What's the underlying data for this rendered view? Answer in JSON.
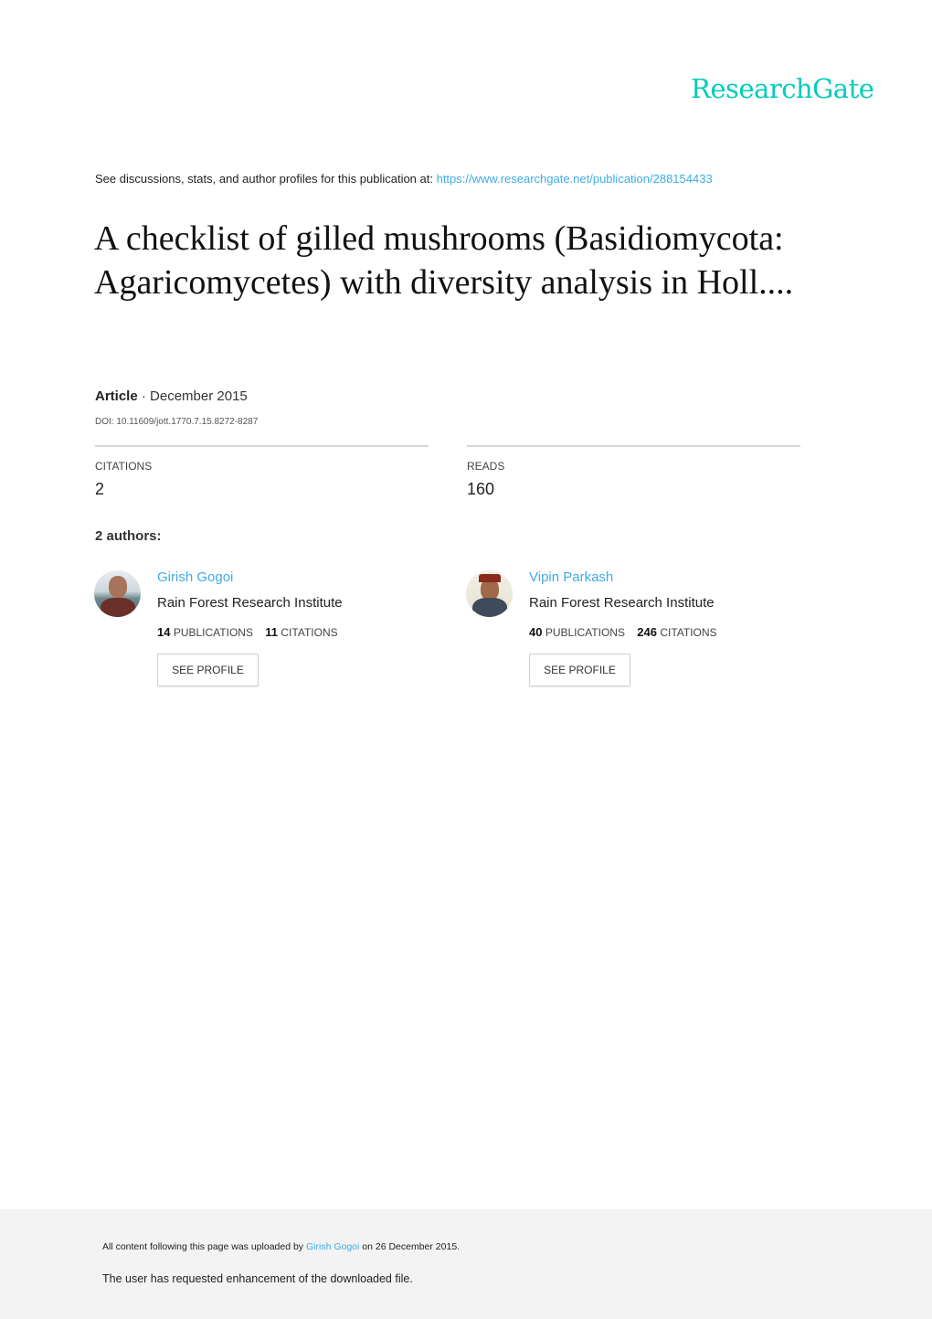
{
  "brand": {
    "logo_text": "ResearchGate",
    "accent_color": "#00ccbb",
    "link_color": "#40ace6"
  },
  "header": {
    "see_discussions_text": "See discussions, stats, and author profiles for this publication at: ",
    "publication_url": "https://www.researchgate.net/publication/288154433"
  },
  "publication": {
    "title": "A checklist of gilled mushrooms (Basidiomycota: Agaricomycetes) with diversity analysis in Holl....",
    "type": "Article",
    "separator": " · ",
    "date": "December 2015",
    "doi": "DOI: 10.11609/jott.1770.7.15.8272-8287"
  },
  "stats": [
    {
      "label": "CITATIONS",
      "value": "2"
    },
    {
      "label": "READS",
      "value": "160"
    }
  ],
  "authors_heading": "2 authors:",
  "authors": [
    {
      "name": "Girish Gogoi",
      "institution": "Rain Forest Research Institute",
      "publications_count": "14",
      "publications_label": "PUBLICATIONS",
      "citations_count": "11",
      "citations_label": "CITATIONS",
      "button_label": "SEE PROFILE",
      "avatar_icon": "person-photo"
    },
    {
      "name": "Vipin Parkash",
      "institution": "Rain Forest Research Institute",
      "publications_count": "40",
      "publications_label": "PUBLICATIONS",
      "citations_count": "246",
      "citations_label": "CITATIONS",
      "button_label": "SEE PROFILE",
      "avatar_icon": "person-photo"
    }
  ],
  "footer": {
    "uploaded_prefix": "All content following this page was uploaded by ",
    "uploader_name": "Girish Gogoi",
    "uploaded_suffix": " on 26 December 2015.",
    "request_text": "The user has requested enhancement of the downloaded file."
  }
}
